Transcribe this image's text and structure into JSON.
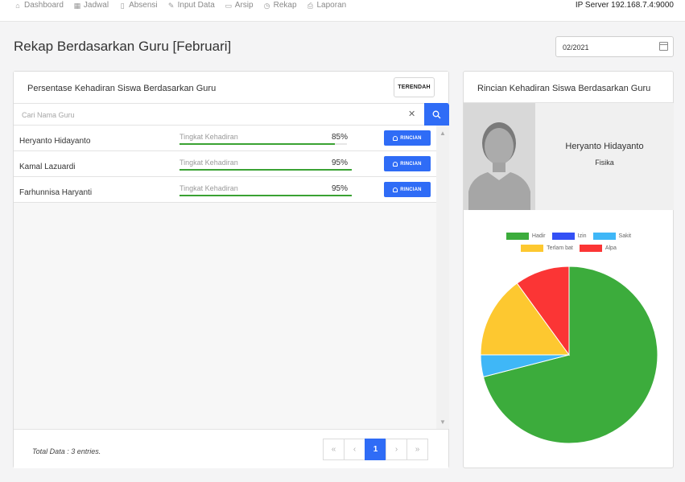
{
  "nav": {
    "items": [
      {
        "label": "Dashboard",
        "icon": "home-icon"
      },
      {
        "label": "Jadwal",
        "icon": "calendar-icon"
      },
      {
        "label": "Absensi",
        "icon": "clipboard-icon"
      },
      {
        "label": "Input Data",
        "icon": "pencil-icon"
      },
      {
        "label": "Arsip",
        "icon": "folder-icon"
      },
      {
        "label": "Rekap",
        "icon": "clock-icon"
      },
      {
        "label": "Laporan",
        "icon": "printer-icon"
      }
    ],
    "server": "IP Server 192.168.7.4:9000"
  },
  "page": {
    "title": "Rekap Berdasarkan Guru [Februari]",
    "date_value": "02/2021"
  },
  "left_panel": {
    "title": "Persentase Kehadiran Siswa Berdasarkan Guru",
    "sort_button": "TERENDAH",
    "search_placeholder": "Cari Nama Guru",
    "rows": [
      {
        "name": "Heryanto Hidayanto",
        "metric_label": "Tingkat Kehadiran",
        "percent": "85%",
        "value": 85,
        "button": "RINCIAN"
      },
      {
        "name": "Kamal Lazuardi",
        "metric_label": "Tingkat Kehadiran",
        "percent": "95%",
        "value": 95,
        "button": "RINCIAN"
      },
      {
        "name": "Farhunnisa Haryanti",
        "metric_label": "Tingkat Kehadiran",
        "percent": "95%",
        "value": 95,
        "button": "RINCIAN"
      }
    ],
    "footer_total": "Total Data : 3 entries.",
    "pagination": {
      "first": "«",
      "prev": "‹",
      "current": "1",
      "next": "›",
      "last": "»"
    }
  },
  "right_panel": {
    "title": "Rincian Kehadiran Siswa Berdasarkan Guru",
    "teacher_name": "Heryanto Hidayanto",
    "teacher_subject": "Fisika"
  },
  "chart_data": {
    "type": "pie",
    "categories": [
      "Hadir",
      "Izin",
      "Sakit",
      "Terlambat",
      "Alpa"
    ],
    "values": [
      71,
      0,
      4,
      15,
      10
    ],
    "colors": [
      "#3cac3c",
      "#3350f5",
      "#3fb7f7",
      "#fdc830",
      "#fb3535"
    ],
    "legend_labels": [
      "Hadir",
      "Izin",
      "Sakit",
      "Terlam bat",
      "Alpa"
    ],
    "legend": "top"
  }
}
